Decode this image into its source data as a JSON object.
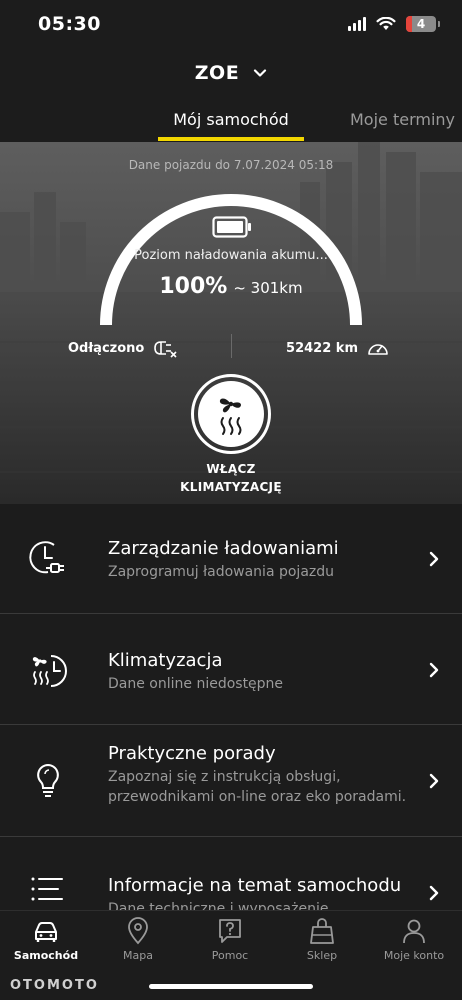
{
  "status": {
    "time": "05:30",
    "battery": "4"
  },
  "header": {
    "car_name": "ZOE"
  },
  "tabs": [
    {
      "label": "Mój samochód",
      "active": true
    },
    {
      "label": "Moje terminy",
      "active": false
    }
  ],
  "vehicle": {
    "updated": "Dane pojazdu do 7.07.2024 05:18",
    "charge_label": "Poziom naładowania akumu...",
    "charge_percent": "100%",
    "range": "~ 301km",
    "plug_status": "Odłączono",
    "odometer": "52422 km",
    "climate_button": {
      "line1": "WŁĄCZ",
      "line2": "KLIMATYZACJĘ"
    }
  },
  "menu": [
    {
      "title": "Zarządzanie ładowaniami",
      "subtitle": "Zaprogramuj ładowania pojazdu",
      "icon": "charge-clock-icon"
    },
    {
      "title": "Klimatyzacja",
      "subtitle": "Dane online niedostępne",
      "icon": "climate-clock-icon"
    },
    {
      "title": "Praktyczne porady",
      "subtitle": "Zapoznaj się z instrukcją obsługi, przewodnikami on-line oraz eko poradami.",
      "icon": "lightbulb-icon"
    },
    {
      "title": "Informacje na temat samochodu",
      "subtitle": "Dane techniczne i wyposażenie",
      "icon": "list-icon"
    }
  ],
  "nav": [
    {
      "label": "Samochód",
      "icon": "car-icon",
      "active": true
    },
    {
      "label": "Mapa",
      "icon": "map-pin-icon",
      "active": false
    },
    {
      "label": "Pomoc",
      "icon": "help-icon",
      "active": false
    },
    {
      "label": "Sklep",
      "icon": "shop-bag-icon",
      "active": false
    },
    {
      "label": "Moje konto",
      "icon": "user-icon",
      "active": false
    }
  ],
  "watermark": "OTOMOTO",
  "colors": {
    "accent": "#f2d600",
    "background": "#1c1c1c"
  }
}
